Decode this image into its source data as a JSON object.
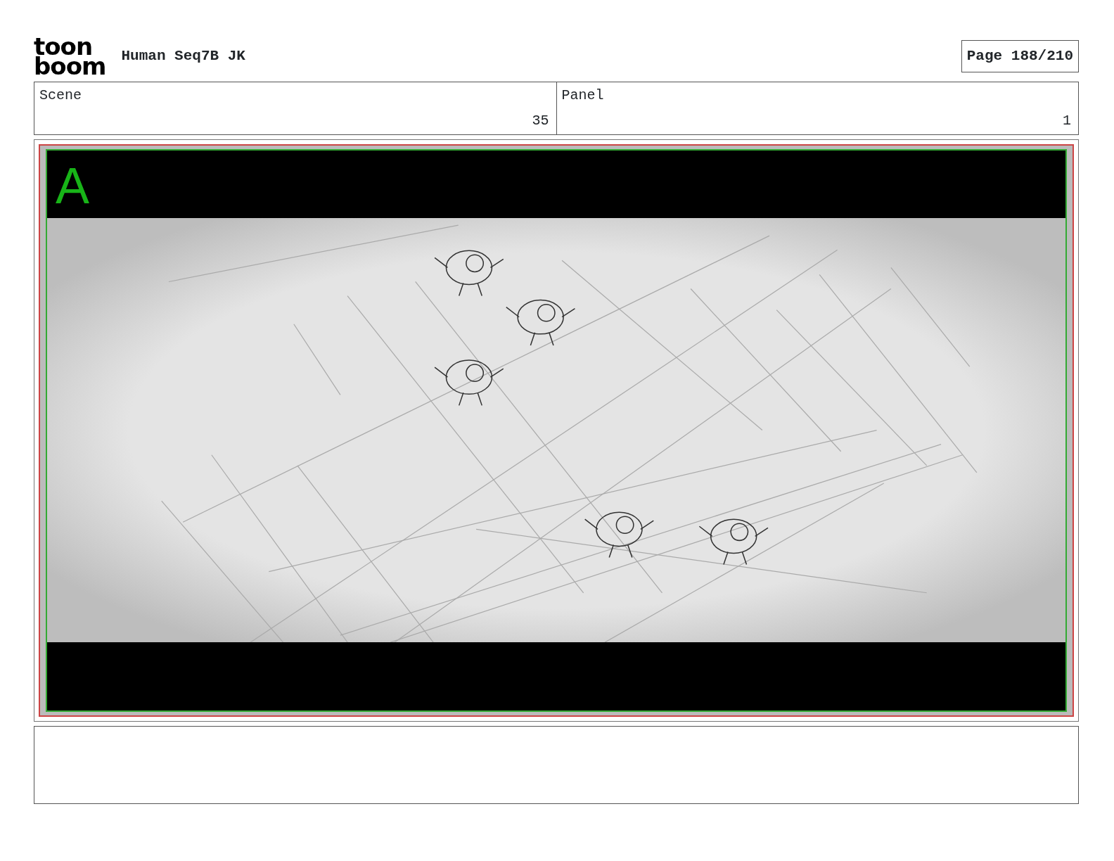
{
  "logo": [
    "toon",
    "boom"
  ],
  "title": "Human Seq7B JK",
  "page": "Page 188/210",
  "fields": [
    {
      "label": "Scene",
      "value": "35"
    },
    {
      "label": "Panel",
      "value": "1"
    }
  ],
  "frame": {
    "layer_label": "A"
  }
}
